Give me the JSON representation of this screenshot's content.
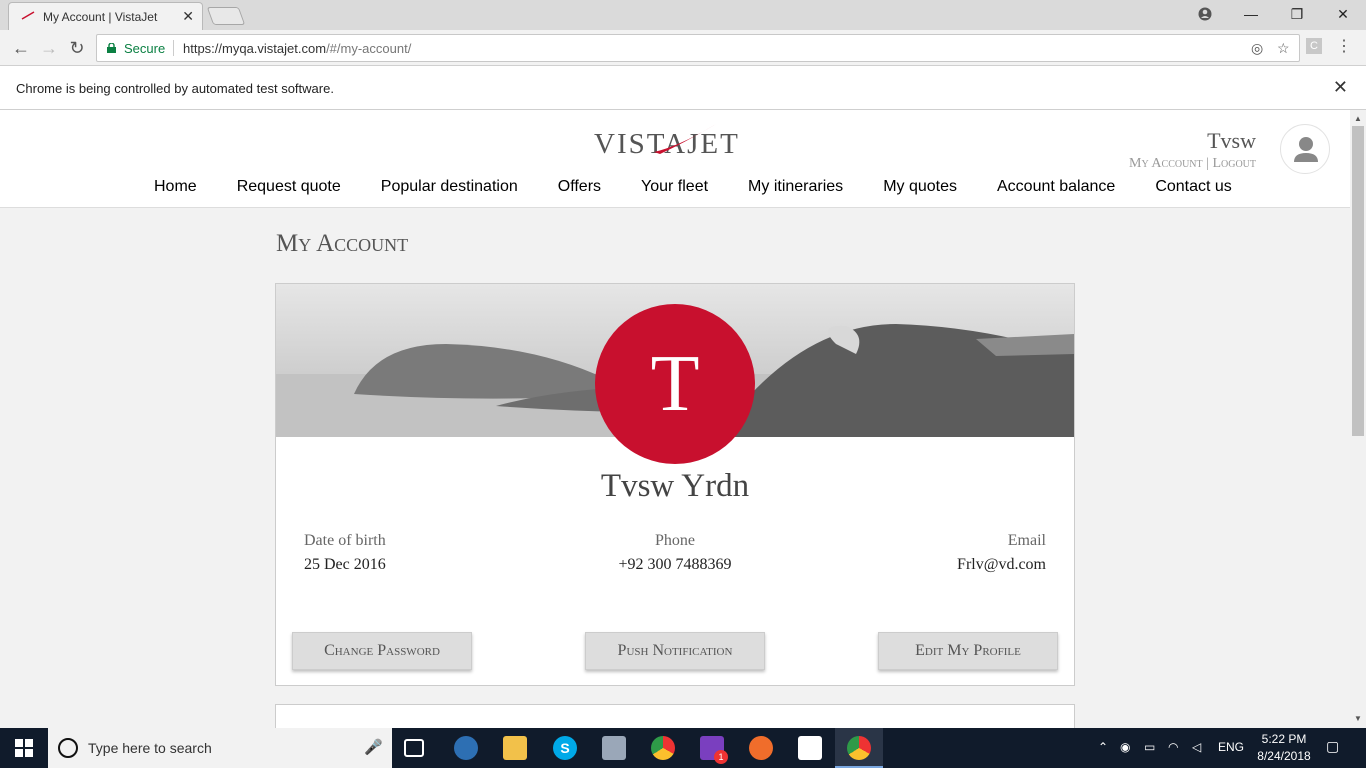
{
  "browser": {
    "tab_title": "My Account | VistaJet",
    "secure_label": "Secure",
    "url_host": "https://myqa.vistajet.com",
    "url_path": "/#/my-account/",
    "ext_label": "C",
    "infobar_message": "Chrome is being controlled by automated test software."
  },
  "site": {
    "logo_text": "VISTAJET",
    "user_name": "Tvsw",
    "my_account_link": "My Account",
    "logout_link": "Logout",
    "link_separator": "|",
    "nav": [
      "Home",
      "Request quote",
      "Popular destination",
      "Offers",
      "Your fleet",
      "My itineraries",
      "My quotes",
      "Account balance",
      "Contact us"
    ],
    "page_title": "My Account",
    "brand_color": "#c8102e"
  },
  "profile": {
    "initial": "T",
    "full_name": "Tvsw Yrdn",
    "dob_label": "Date of birth",
    "dob_value": "25 Dec 2016",
    "phone_label": "Phone",
    "phone_value": "+92 300 7488369",
    "email_label": "Email",
    "email_value": "Frlv@vd.com",
    "buttons": {
      "change_password": "Change Password",
      "push_notification": "Push Notification",
      "edit_profile": "Edit My Profile"
    }
  },
  "taskbar": {
    "search_placeholder": "Type here to search",
    "language": "ENG",
    "time": "5:22 PM",
    "date": "8/24/2018",
    "badge_count": "1"
  }
}
